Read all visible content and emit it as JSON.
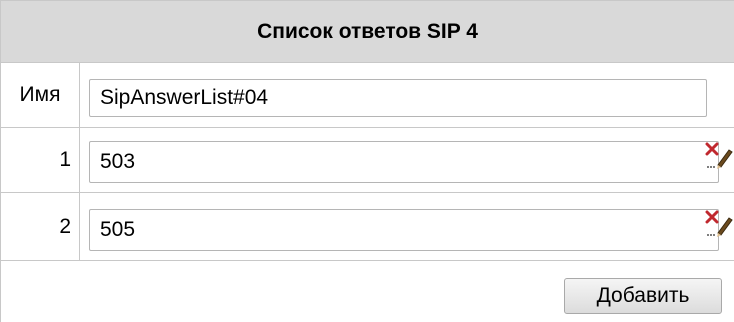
{
  "header": {
    "title": "Список ответов SIP 4"
  },
  "name_row": {
    "label": "Имя",
    "value": "SipAnswerList#04"
  },
  "answers": [
    {
      "index": "1",
      "value": "503"
    },
    {
      "index": "2",
      "value": "505"
    }
  ],
  "actions": {
    "add_label": "Добавить"
  },
  "icons": {
    "edit_delete": "delete-edit-icon"
  }
}
